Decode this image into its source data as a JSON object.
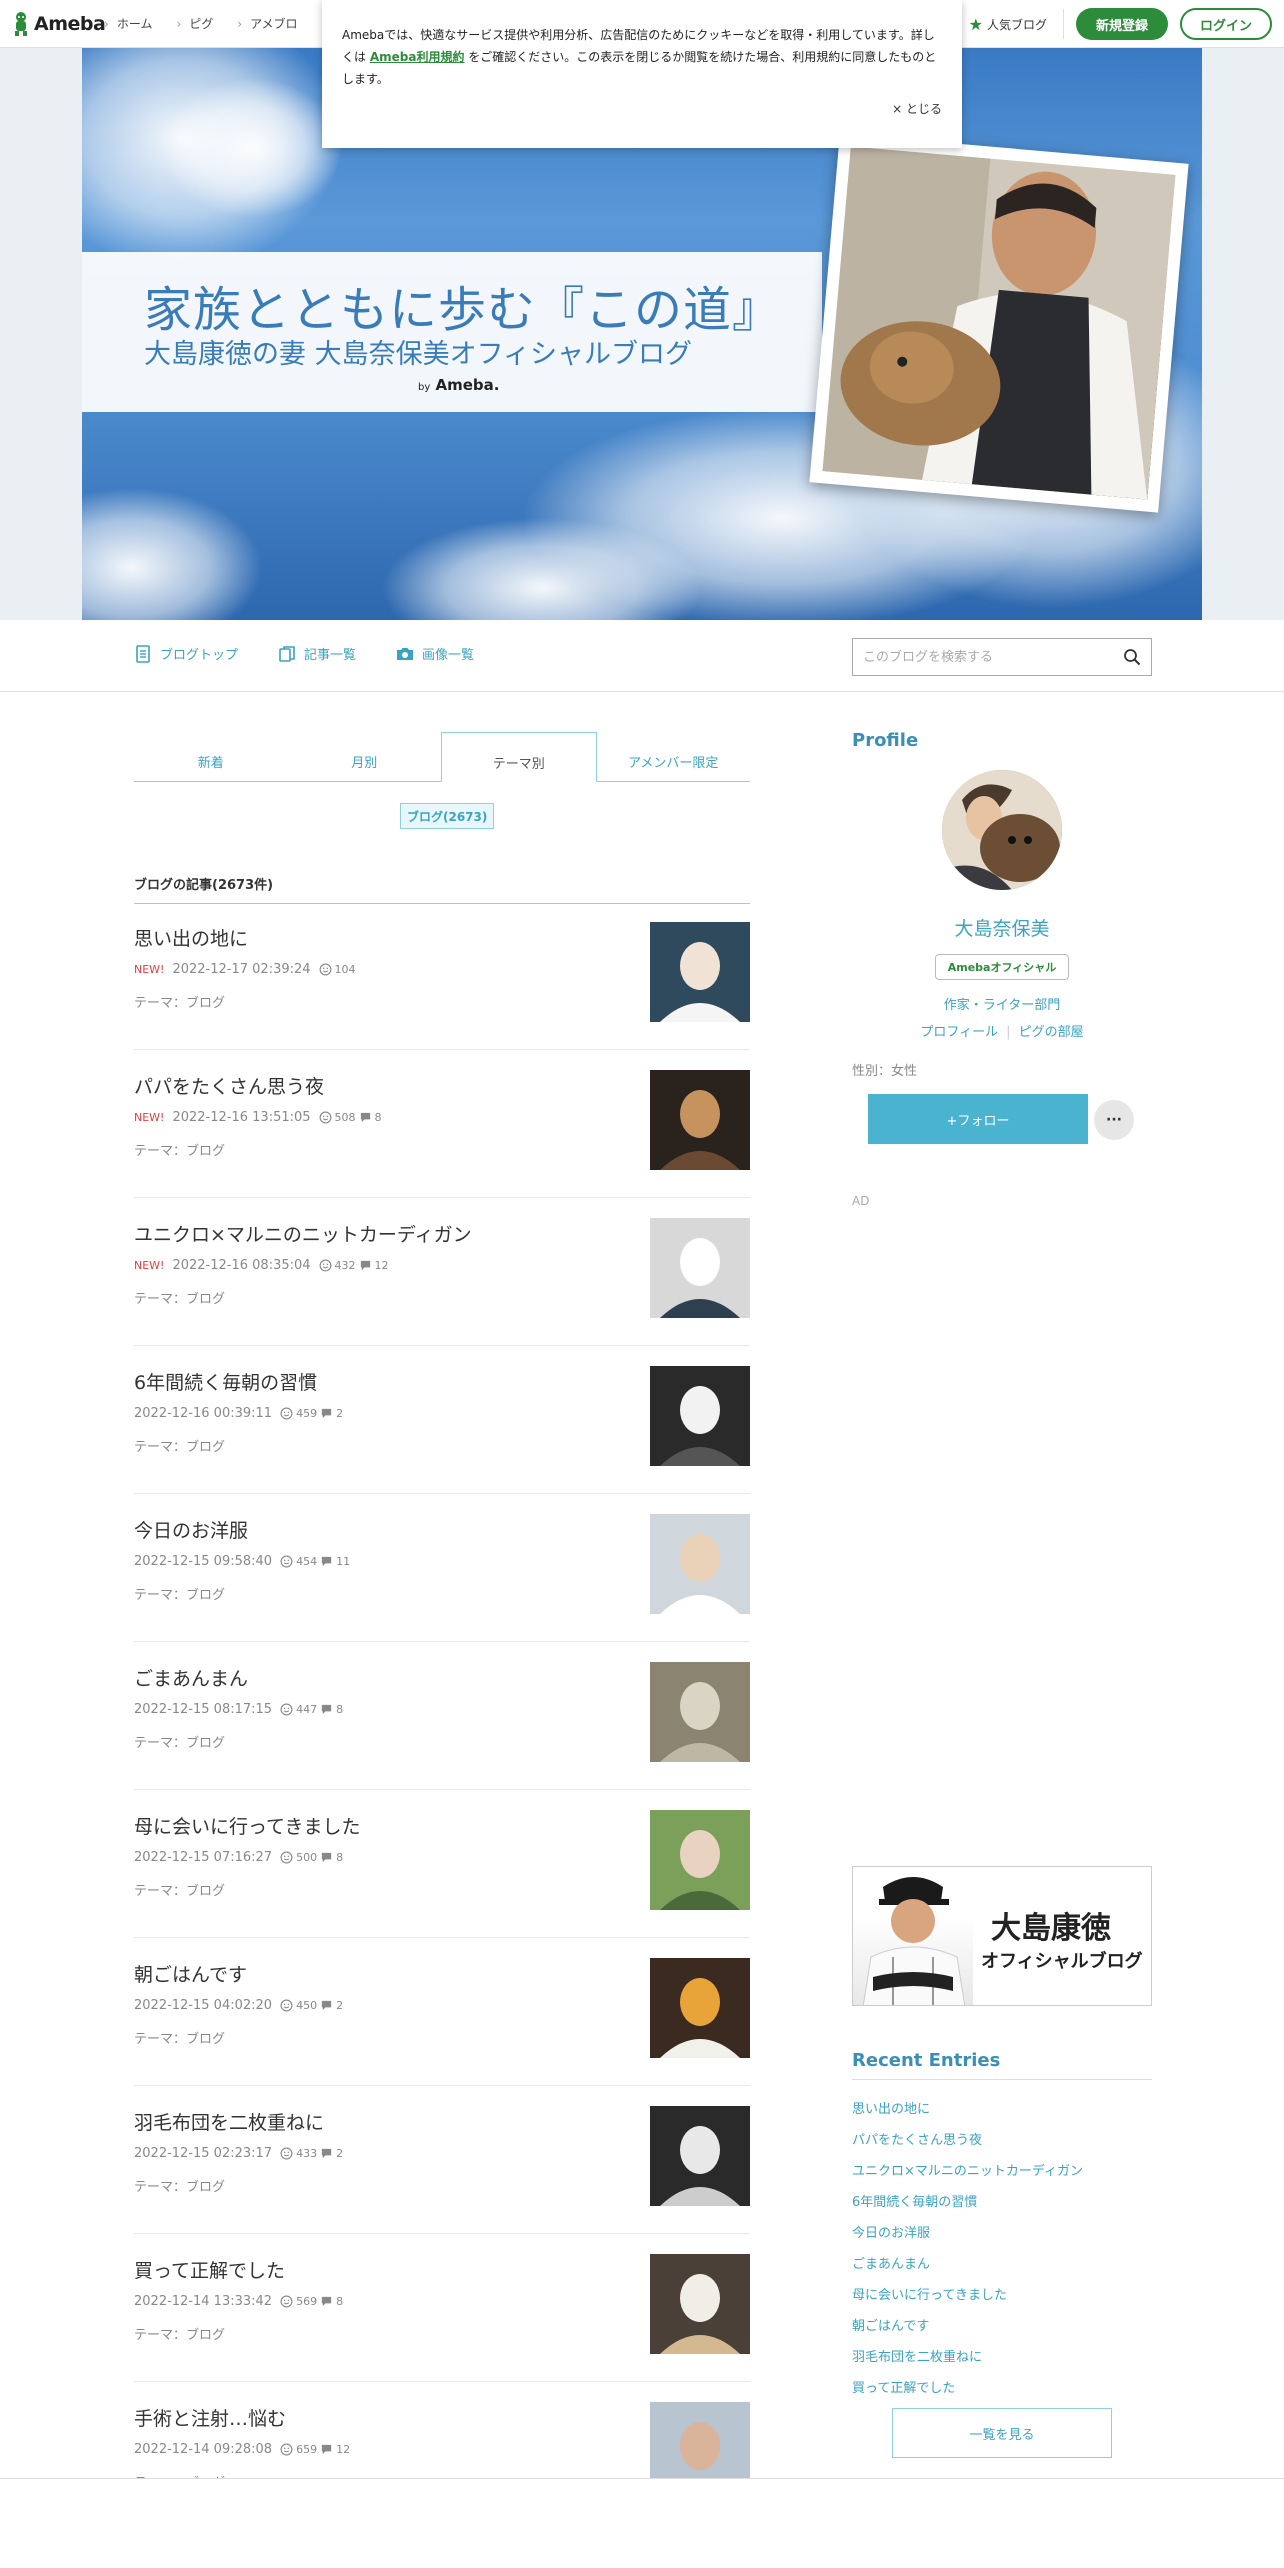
{
  "global_header": {
    "logo_text": "Ameba",
    "nav": [
      "ホーム",
      "ピグ",
      "アメブロ"
    ],
    "popular_label": "人気ブログ",
    "register_label": "新規登録",
    "login_label": "ログイン"
  },
  "cookie_notice": {
    "text_before": "Amebaでは、快適なサービス提供や利用分析、広告配信のためにクッキーなどを取得・利用しています。詳しくは ",
    "link_text": "Ameba利用規約",
    "text_after": " をご確認ください。この表示を閉じるか閲覧を続けた場合、利用規約に同意したものとします。",
    "close_label": "× とじる"
  },
  "banner": {
    "title": "家族とともに歩む『この道』",
    "subtitle": "大島康徳の妻 大島奈保美オフィシャルブログ",
    "by_prefix": "by",
    "by_brand": "Ameba."
  },
  "blog_nav": {
    "items": [
      "ブログトップ",
      "記事一覧",
      "画像一覧"
    ],
    "search_placeholder": "このブログを検索する"
  },
  "tabs": {
    "items": [
      "新着",
      "月別",
      "テーマ別",
      "アメンバー限定"
    ],
    "active": "テーマ別"
  },
  "theme_tag": "ブログ(2673)",
  "list_heading": "ブログの記事(2673件)",
  "entries": [
    {
      "title": "思い出の地に",
      "new": "NEW!",
      "date": "2022-12-17 02:39:24",
      "likes": "104",
      "comments": "",
      "theme": "テーマ：ブログ"
    },
    {
      "title": "パパをたくさん思う夜",
      "new": "NEW!",
      "date": "2022-12-16 13:51:05",
      "likes": "508",
      "comments": "8",
      "theme": "テーマ：ブログ"
    },
    {
      "title": "ユニクロ×マルニのニットカーディガン",
      "new": "NEW!",
      "date": "2022-12-16 08:35:04",
      "likes": "432",
      "comments": "12",
      "theme": "テーマ：ブログ"
    },
    {
      "title": "6年間続く毎朝の習慣",
      "new": "",
      "date": "2022-12-16 00:39:11",
      "likes": "459",
      "comments": "2",
      "theme": "テーマ：ブログ"
    },
    {
      "title": "今日のお洋服",
      "new": "",
      "date": "2022-12-15 09:58:40",
      "likes": "454",
      "comments": "11",
      "theme": "テーマ：ブログ"
    },
    {
      "title": "ごまあんまん",
      "new": "",
      "date": "2022-12-15 08:17:15",
      "likes": "447",
      "comments": "8",
      "theme": "テーマ：ブログ"
    },
    {
      "title": "母に会いに行ってきました",
      "new": "",
      "date": "2022-12-15 07:16:27",
      "likes": "500",
      "comments": "8",
      "theme": "テーマ：ブログ"
    },
    {
      "title": "朝ごはんです",
      "new": "",
      "date": "2022-12-15 04:02:20",
      "likes": "450",
      "comments": "2",
      "theme": "テーマ：ブログ"
    },
    {
      "title": "羽毛布団を二枚重ねに",
      "new": "",
      "date": "2022-12-15 02:23:17",
      "likes": "433",
      "comments": "2",
      "theme": "テーマ：ブログ"
    },
    {
      "title": "買って正解でした",
      "new": "",
      "date": "2022-12-14 13:33:42",
      "likes": "569",
      "comments": "8",
      "theme": "テーマ：ブログ"
    },
    {
      "title": "手術と注射…悩む",
      "new": "",
      "date": "2022-12-14 09:28:08",
      "likes": "659",
      "comments": "12",
      "theme": "テーマ：ブログ"
    }
  ],
  "profile": {
    "heading": "Profile",
    "name": "大島奈保美",
    "badge": "Amebaオフィシャル",
    "category": "作家・ライター部門",
    "links": [
      "プロフィール",
      "ピグの部屋"
    ],
    "sex": "性別：女性",
    "follow_label": "+フォロー",
    "more_label": "···",
    "ad_label": "AD"
  },
  "ad_banner": {
    "title": "大島康徳",
    "subtitle": "オフィシャルブログ"
  },
  "recent": {
    "heading": "Recent Entries",
    "items": [
      "思い出の地に",
      "パパをたくさん思う夜",
      "ユニクロ×マルニのニットカーディガン",
      "6年間続く毎朝の習慣",
      "今日のお洋服",
      "ごまあんまん",
      "母に会いに行ってきました",
      "朝ごはんです",
      "羽毛布団を二枚重ねに",
      "買って正解でした"
    ],
    "more_label": "一覧を見る"
  },
  "colors": {
    "brand_green": "#2d8c3c",
    "link_blue": "#3aa3c2",
    "new_red": "#e04040",
    "follow_blue": "#4ab3d0"
  }
}
